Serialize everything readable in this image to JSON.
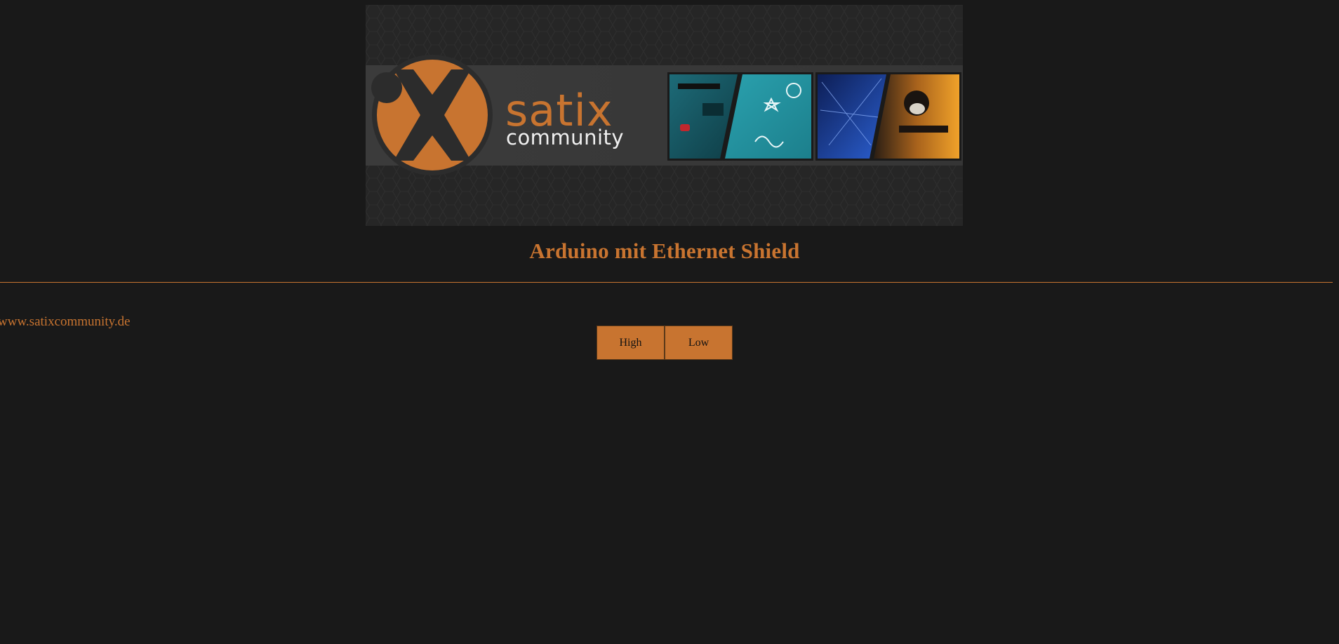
{
  "colors": {
    "background": "#191919",
    "accent": "#c87430",
    "banner_band": "#3a3a3a",
    "banner_bg": "#262626"
  },
  "banner": {
    "logo_word_1": "satix",
    "logo_word_2": "community",
    "thumbnail_icons": [
      "arduino-board-image",
      "doodle-pattern-image",
      "network-web-image",
      "soldier-game-image"
    ]
  },
  "header": {
    "title": "Arduino mit Ethernet Shield"
  },
  "sidebar": {
    "site_link": "www.satixcommunity.de"
  },
  "controls": {
    "high_label": "High",
    "low_label": "Low"
  }
}
